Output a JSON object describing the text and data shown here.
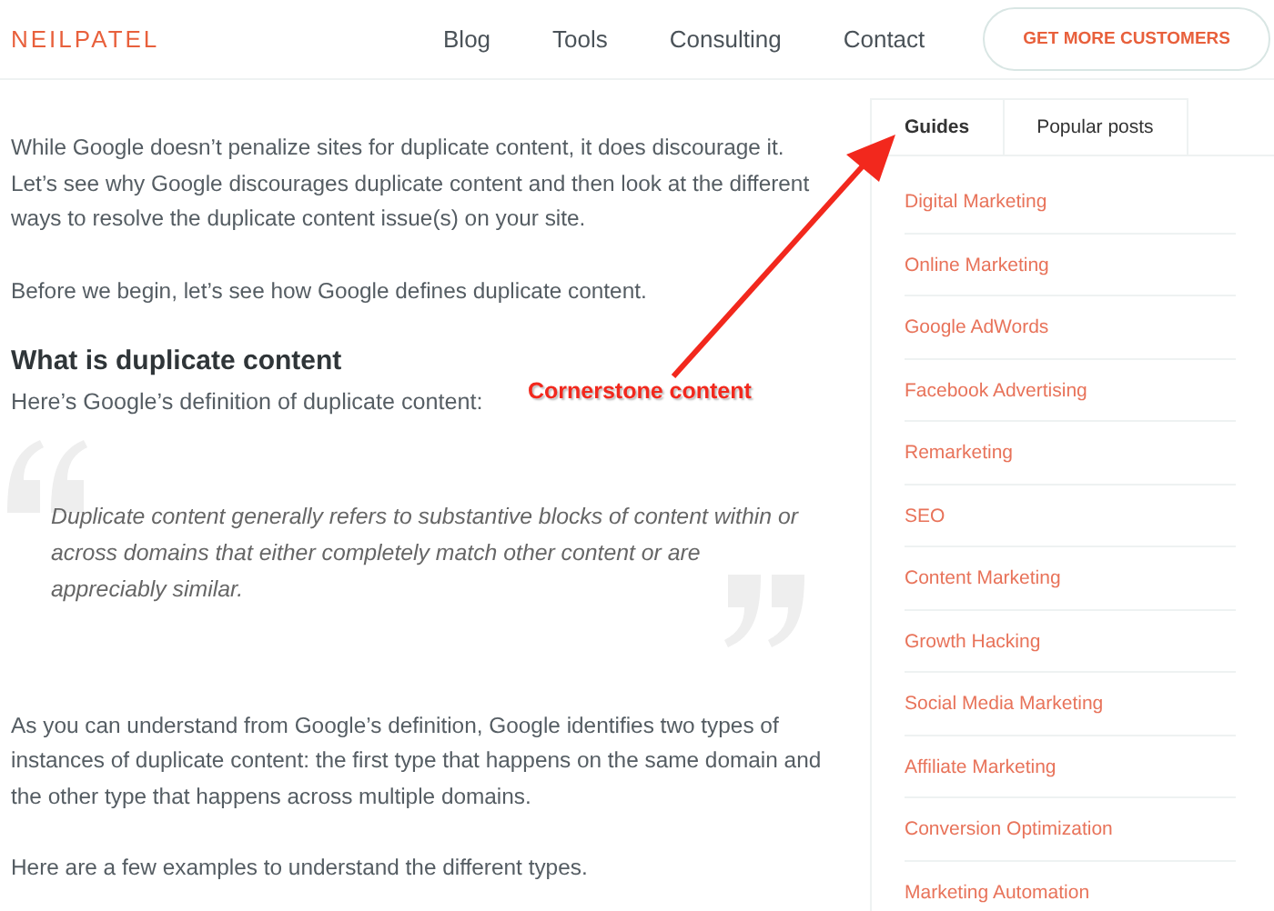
{
  "header": {
    "logo": "NEILPATEL",
    "nav": [
      "Blog",
      "Tools",
      "Consulting",
      "Contact"
    ],
    "cta": "GET MORE CUSTOMERS"
  },
  "article": [
    {
      "kind": "paragraph",
      "text": "While Google doesn’t penalize sites for duplicate content, it does discourage it. Let’s see why Google discourages duplicate content and then look at the different ways to resolve the duplicate content issue(s) on your site."
    },
    {
      "kind": "paragraph",
      "text": "Before we begin, let’s see how Google defines duplicate content."
    },
    {
      "kind": "heading",
      "text": "What is duplicate content"
    },
    {
      "kind": "lead",
      "text": "Here’s Google’s definition of duplicate content:"
    },
    {
      "kind": "quote",
      "text": "Duplicate content generally refers to substantive blocks of content within or across domains that either completely match other content or are appreciably similar."
    },
    {
      "kind": "paragraph",
      "text": "As you can understand from Google’s definition, Google identifies two types of instances of duplicate content: the first type that happens on the same domain and the other type that happens across multiple domains."
    },
    {
      "kind": "paragraph",
      "text": "Here are a few examples to understand the different types."
    }
  ],
  "sidebar": {
    "tabs": [
      {
        "label": "Guides",
        "selected": true
      },
      {
        "label": "Popular posts",
        "selected": false
      }
    ],
    "items": [
      "Digital Marketing",
      "Online Marketing",
      "Google AdWords",
      "Facebook Advertising",
      "Remarketing",
      "SEO",
      "Content Marketing",
      "Growth Hacking",
      "Social Media Marketing",
      "Affiliate Marketing",
      "Conversion Optimization",
      "Marketing Automation"
    ]
  },
  "annotation": {
    "text": "Cornerstone content"
  }
}
